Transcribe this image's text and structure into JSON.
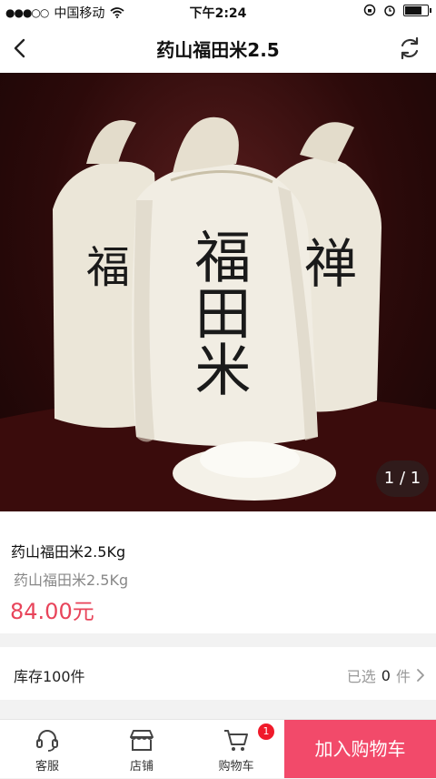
{
  "status_bar": {
    "signal": "●●●○○",
    "carrier": "中国移动",
    "time": "下午2:24",
    "battery_level": 0.8
  },
  "nav": {
    "title": "药山福田米2.5",
    "back_icon": "chevron-left-icon",
    "refresh_icon": "refresh-icon"
  },
  "product": {
    "image_counter": "1 / 1",
    "name": "药山福田米2.5Kg",
    "subtitle": "药山福田米2.5Kg",
    "price": "84.00元",
    "bag_text_center": "福田米",
    "bag_text_left": "福",
    "bag_text_right": "禅"
  },
  "stock": {
    "label": "库存100件",
    "selected_prefix": "已选",
    "selected_count": "0",
    "selected_suffix": "件"
  },
  "tabbar": {
    "service_label": "客服",
    "store_label": "店铺",
    "cart_label": "购物车",
    "cart_badge": "1",
    "add_to_cart_label": "加入购物车"
  },
  "colors": {
    "accent": "#f24a6a",
    "price": "#e8445a",
    "badge": "#f01a2a"
  }
}
